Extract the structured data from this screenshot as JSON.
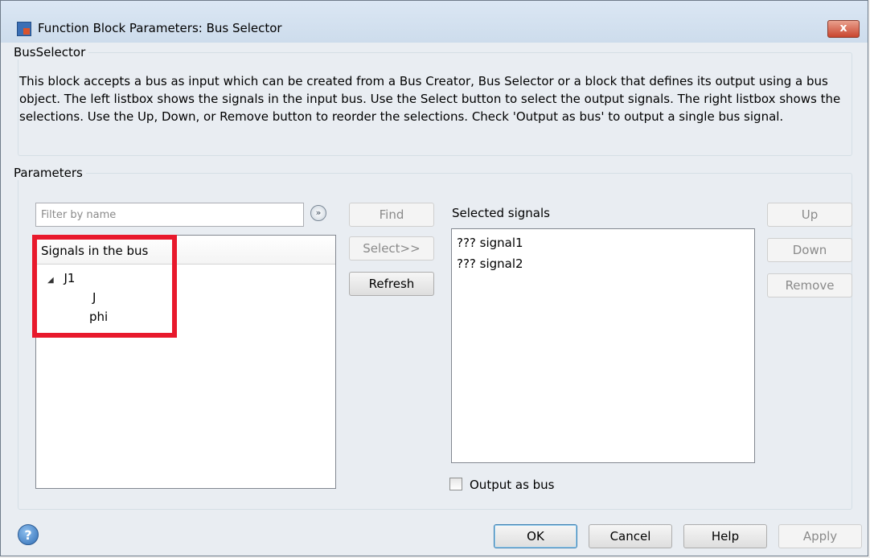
{
  "window": {
    "title": "Function Block Parameters: Bus Selector",
    "close_glyph": "x"
  },
  "group_block": {
    "legend": "BusSelector",
    "description": "This block accepts a bus as input which can be created from a Bus Creator, Bus Selector or a block that defines its output using a bus object. The left listbox shows the signals in the input bus. Use the Select button to select the output signals. The right listbox shows the selections. Use the Up, Down, or Remove button to reorder the selections. Check 'Output as bus' to output a single bus signal."
  },
  "group_params": {
    "legend": "Parameters"
  },
  "filter": {
    "placeholder": "Filter by name",
    "options_glyph": "»"
  },
  "buttons": {
    "find": "Find",
    "select": "Select>>",
    "refresh": "Refresh",
    "up": "Up",
    "down": "Down",
    "remove": "Remove",
    "ok": "OK",
    "cancel": "Cancel",
    "help": "Help",
    "apply": "Apply"
  },
  "signals_list": {
    "header": "Signals in the bus",
    "tree": [
      {
        "label": "J1",
        "expanded": true,
        "arrow": "◢"
      },
      {
        "label": "J"
      },
      {
        "label": "phi"
      }
    ]
  },
  "selected_list": {
    "label": "Selected signals",
    "items": [
      "??? signal1",
      "??? signal2"
    ]
  },
  "output_as_bus": {
    "label": "Output as bus",
    "checked": false
  },
  "help_glyph": "?",
  "icons": {
    "title": "simulink-block-icon",
    "filter_options": "double-chevron-down-icon",
    "help": "help-icon"
  }
}
